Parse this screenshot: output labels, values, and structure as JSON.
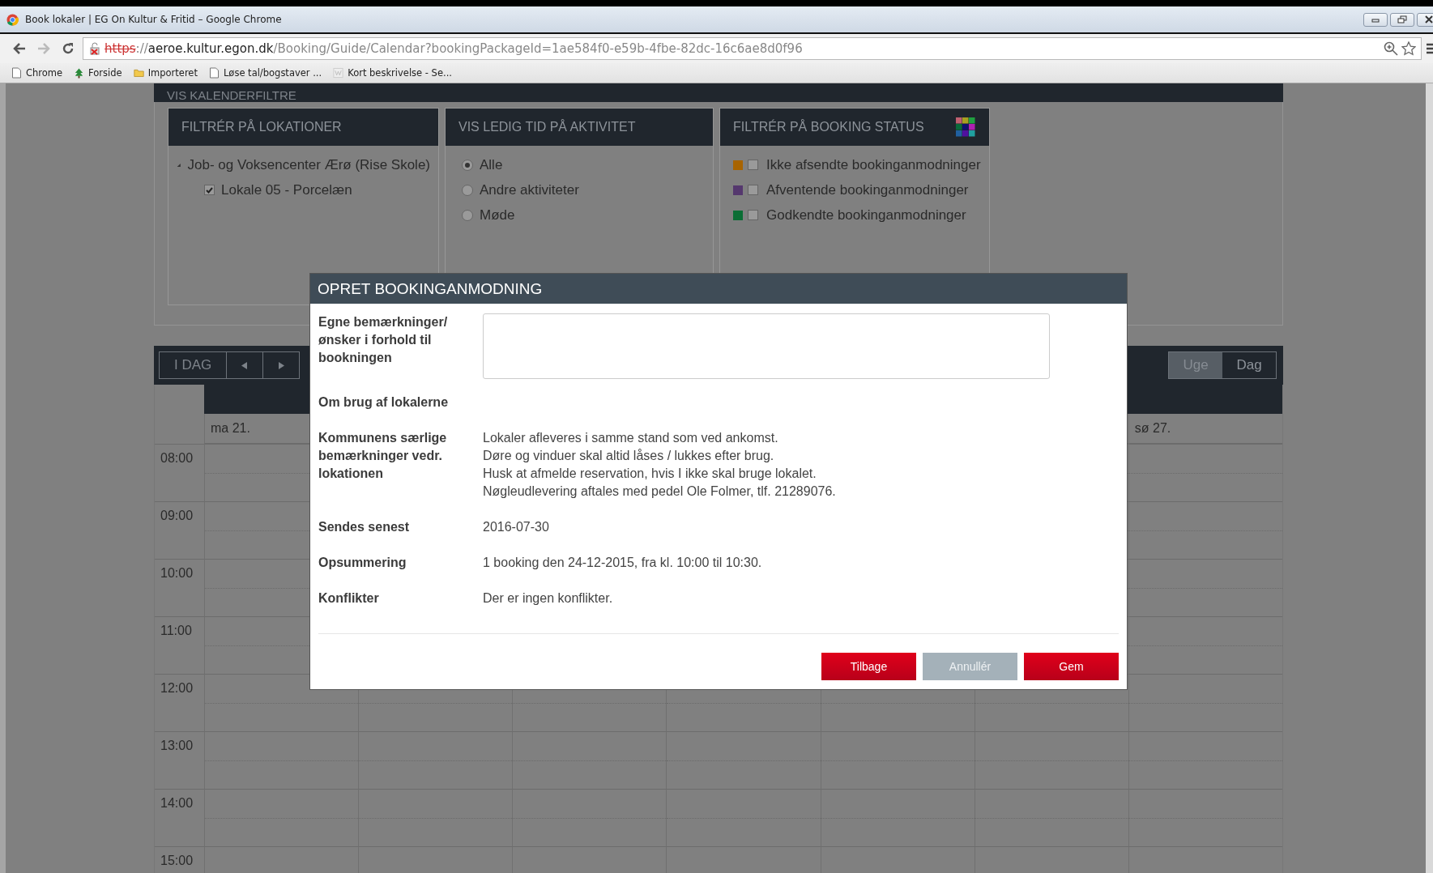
{
  "browser": {
    "title": "Book lokaler | EG On Kultur & Fritid – Google Chrome",
    "url": [
      {
        "text": "https",
        "kind": "insecure"
      },
      {
        "text": "://",
        "kind": "dim"
      },
      {
        "text": "aeroe.kultur.egon.dk",
        "kind": "host"
      },
      {
        "text": "/Booking/Guide/Calendar?bookingPackageId=1ae584f0-e59b-4fbe-82dc-16c6ae8d0f96",
        "kind": "dim"
      }
    ],
    "bookmarks": [
      {
        "label": "Chrome",
        "kind": "page"
      },
      {
        "label": "Forside",
        "kind": "site"
      },
      {
        "label": "Importeret",
        "kind": "folder"
      },
      {
        "label": "Løse tal/bogstaver ...",
        "kind": "page"
      },
      {
        "label": "Kort beskrivelse - Se...",
        "kind": "faded"
      }
    ]
  },
  "filters": {
    "title": "VIS KALENDERFILTRE",
    "locations": {
      "title": "FILTRÉR PÅ LOKATIONER",
      "tree": [
        {
          "label": "Job- og Voksencenter Ærø (Rise Skole)",
          "expanded": true,
          "children": [
            {
              "label": "Lokale 05 - Porcelæn",
              "checked": true
            }
          ]
        }
      ]
    },
    "activities": {
      "title": "VIS LEDIG TID PÅ AKTIVITET",
      "options": [
        {
          "label": "Alle",
          "selected": true
        },
        {
          "label": "Andre aktiviteter",
          "selected": false
        },
        {
          "label": "Møde",
          "selected": false
        }
      ]
    },
    "status": {
      "title": "FILTRÉR PÅ BOOKING STATUS",
      "items": [
        {
          "label": "Ikke afsendte bookinganmodninger",
          "color": "#a86400",
          "checked": false
        },
        {
          "label": "Afventende bookinganmodninger",
          "color": "#55386e",
          "checked": false
        },
        {
          "label": "Godkendte bookinganmodninger",
          "color": "#0b6e35",
          "checked": false
        }
      ]
    }
  },
  "calendar": {
    "today": "I DAG",
    "views": [
      {
        "label": "Uge",
        "selected": true
      },
      {
        "label": "Dag",
        "selected": false
      }
    ],
    "first_day": "ma 21.",
    "last_day": "sø 27.",
    "hours": [
      "08:00",
      "09:00",
      "10:00",
      "11:00",
      "12:00",
      "13:00",
      "14:00",
      "15:00"
    ]
  },
  "dialog": {
    "title": "OPRET BOOKINGANMODNING",
    "fields": [
      {
        "label": "Egne bemærkninger/ ønsker i forhold til bookningen",
        "kind": "textarea"
      },
      {
        "label": "Om brug af lokalerne",
        "kind": "label"
      },
      {
        "label": "Kommunens særlige bemærkninger vedr. lokationen",
        "kind": "text",
        "lines": [
          "Lokaler afleveres i samme stand som ved ankomst.",
          "Døre og vinduer skal altid låses / lukkes efter brug.",
          "Husk at afmelde reservation, hvis I ikke skal bruge lokalet.",
          "Nøgleudlevering aftales med pedel Ole Folmer, tlf. 21289076."
        ]
      },
      {
        "label": "Sendes senest",
        "kind": "text",
        "lines": [
          "2016-07-30"
        ]
      },
      {
        "label": "Opsummering",
        "kind": "text",
        "lines": [
          "1 booking den 24-12-2015, fra kl. 10:00 til 10:30."
        ]
      },
      {
        "label": "Konflikter",
        "kind": "text",
        "lines": [
          "Der er ingen konflikter."
        ]
      }
    ],
    "buttons": [
      {
        "label": "Tilbage",
        "kind": "primary"
      },
      {
        "label": "Annullér",
        "kind": "secondary"
      },
      {
        "label": "Gem",
        "kind": "primary"
      }
    ]
  }
}
